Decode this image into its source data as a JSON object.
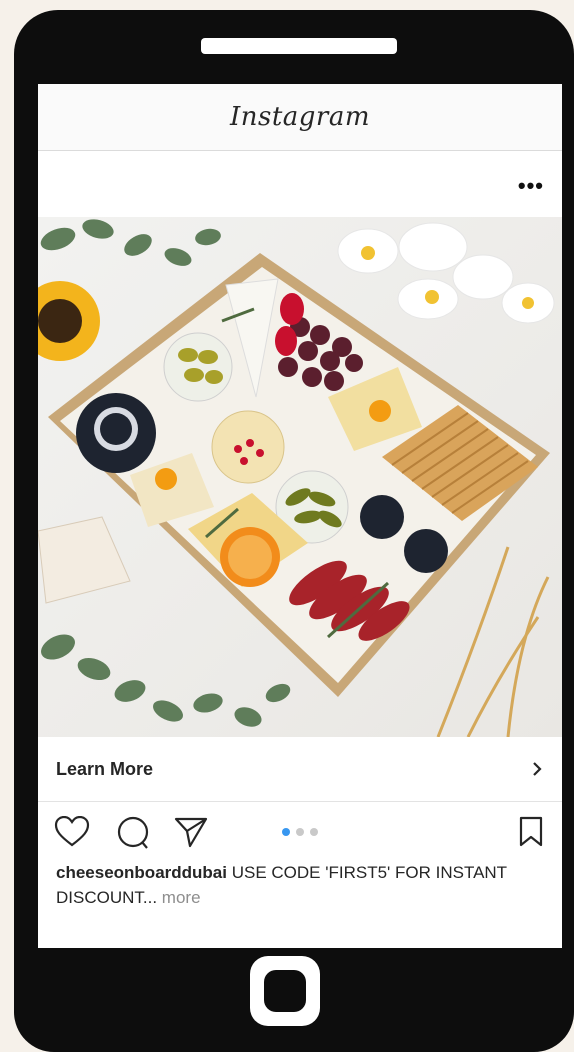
{
  "app": {
    "title": "Instagram"
  },
  "post": {
    "learn_more": "Learn More",
    "username": "cheeseonboarddubai",
    "caption": " USE CODE 'FIRST5' FOR INSTANT DISCOUNT...",
    "more": " more",
    "carousel": {
      "total": 3,
      "active": 1
    }
  },
  "icons": {
    "more": "more-options-icon",
    "like": "heart-icon",
    "comment": "comment-icon",
    "share": "paper-plane-icon",
    "save": "bookmark-icon",
    "chevron": "chevron-right-icon"
  },
  "colors": {
    "accent": "#3897f0",
    "phone": "#0d0d0d"
  }
}
